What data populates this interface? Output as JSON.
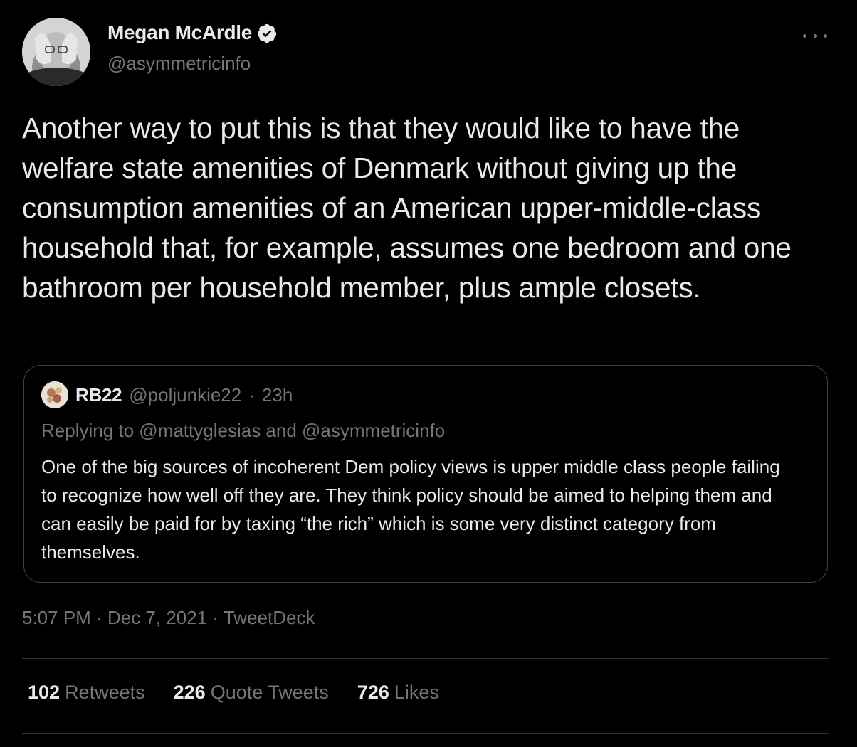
{
  "author": {
    "name": "Megan McArdle",
    "handle": "@asymmetricinfo"
  },
  "tweet_text": "Another way to put this is that they would like to have the welfare state amenities of Denmark without giving up the consumption amenities of an American upper-middle-class household that, for example, assumes one bedroom and one bathroom per household member, plus ample closets.",
  "quoted_tweet": {
    "name": "RB22",
    "handle": "@poljunkie22",
    "separator": "·",
    "time": "23h",
    "replying_to": "Replying to @mattyglesias and @asymmetricinfo",
    "text": "One of the big sources of incoherent Dem policy views is upper middle class people failing to recognize how well off they are. They think policy should be aimed to helping them and can easily be paid for by taxing “the rich” which is some very distinct category from themselves."
  },
  "meta": {
    "time": "5:07 PM",
    "separator": "·",
    "date": "Dec 7, 2021",
    "source": "TweetDeck"
  },
  "stats": {
    "retweets_count": "102",
    "retweets_label": "Retweets",
    "quotes_count": "226",
    "quotes_label": "Quote Tweets",
    "likes_count": "726",
    "likes_label": "Likes"
  },
  "colors": {
    "background": "#000000",
    "primary_text": "#e7e9ea",
    "secondary_text": "#71767b",
    "border": "#3e4144",
    "divider": "#2f3336"
  },
  "icons": [
    "avatar",
    "verified-badge-icon",
    "more-options-icon"
  ]
}
